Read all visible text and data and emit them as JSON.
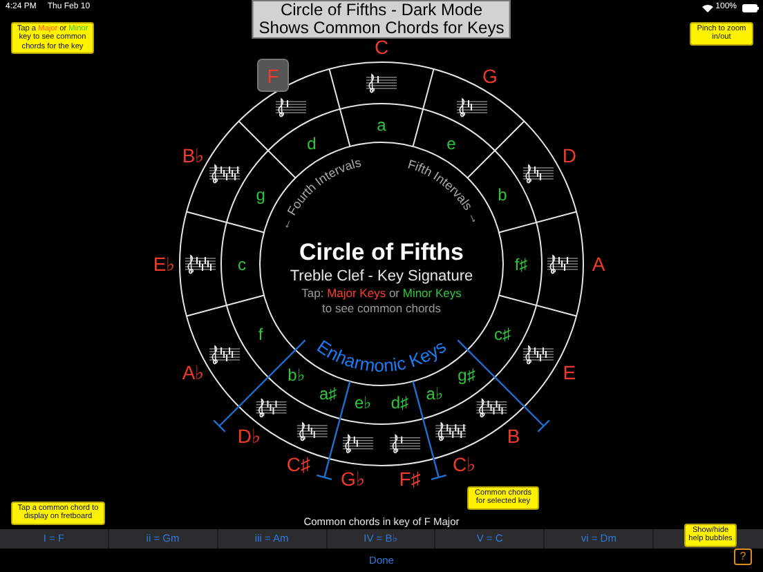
{
  "status_bar": {
    "time": "4:24 PM",
    "date": "Thu Feb 10",
    "battery": "100%"
  },
  "title": [
    "Circle of Fifths - Dark Mode",
    "Shows Common Chords for Keys"
  ],
  "help_bubbles": [
    {
      "segments": [
        {
          "text": "Tap a ",
          "kind": "plain"
        },
        {
          "text": "Major",
          "kind": "major"
        },
        {
          "text": " or ",
          "kind": "plain"
        },
        {
          "text": "Minor",
          "kind": "minor"
        },
        {
          "text": " key to see common chords for the key",
          "kind": "plain"
        }
      ]
    },
    {
      "segments": [
        {
          "text": "Pinch to zoom in/out",
          "kind": "plain"
        }
      ]
    },
    {
      "segments": [
        {
          "text": "Tap a common chord to display on fretboard",
          "kind": "plain"
        }
      ]
    },
    {
      "segments": [
        {
          "text": "Common chords for selected key",
          "kind": "plain"
        }
      ]
    },
    {
      "segments": [
        {
          "text": "Show/hide help bubbles",
          "kind": "plain"
        }
      ]
    }
  ],
  "circle": {
    "title": "Circle of Fifths",
    "subtitle": "Treble Clef - Key Signature",
    "instruction": [
      {
        "text": "Tap: ",
        "kind": "plain"
      },
      {
        "text": "Major Keys",
        "kind": "major"
      },
      {
        "text": " or ",
        "kind": "plain"
      },
      {
        "text": "Minor Keys",
        "kind": "minor"
      }
    ],
    "instruction_line2": "to see common chords",
    "fourth_label": "← Fourth Intervals",
    "fifth_label": "Fifth Intervals →",
    "enharmonic_label": "Enharmonic Keys",
    "major_keys": [
      {
        "label": "C",
        "kind": "key",
        "selected": false
      },
      {
        "label": "G",
        "kind": "key",
        "selected": false
      },
      {
        "label": "D",
        "kind": "key",
        "selected": false
      },
      {
        "label": "A",
        "kind": "key",
        "selected": false
      },
      {
        "label": "E",
        "kind": "key",
        "selected": false
      },
      {
        "label": "B",
        "kind": "enharmonic",
        "selected": false
      },
      {
        "label": "C♭",
        "kind": "enharmonic",
        "selected": false
      },
      {
        "label": "F♯",
        "kind": "enharmonic",
        "selected": false
      },
      {
        "label": "G♭",
        "kind": "enharmonic",
        "selected": false
      },
      {
        "label": "C♯",
        "kind": "enharmonic",
        "selected": false
      },
      {
        "label": "D♭",
        "kind": "enharmonic",
        "selected": false
      },
      {
        "label": "A♭",
        "kind": "key",
        "selected": false
      },
      {
        "label": "E♭",
        "kind": "key",
        "selected": false
      },
      {
        "label": "B♭",
        "kind": "key",
        "selected": false
      },
      {
        "label": "F",
        "kind": "key",
        "selected": true
      }
    ],
    "minor_keys": [
      {
        "label": "a",
        "kind": "key",
        "selected": false
      },
      {
        "label": "e",
        "kind": "key",
        "selected": false
      },
      {
        "label": "b",
        "kind": "key",
        "selected": false
      },
      {
        "label": "f♯",
        "kind": "key",
        "selected": false
      },
      {
        "label": "c♯",
        "kind": "key",
        "selected": false
      },
      {
        "label": "g♯",
        "kind": "enharmonic",
        "selected": false
      },
      {
        "label": "a♭",
        "kind": "enharmonic",
        "selected": false
      },
      {
        "label": "d♯",
        "kind": "enharmonic",
        "selected": false
      },
      {
        "label": "e♭",
        "kind": "enharmonic",
        "selected": false
      },
      {
        "label": "a♯",
        "kind": "enharmonic",
        "selected": false
      },
      {
        "label": "b♭",
        "kind": "enharmonic",
        "selected": false
      },
      {
        "label": "f",
        "kind": "key",
        "selected": false
      },
      {
        "label": "c",
        "kind": "key",
        "selected": false
      },
      {
        "label": "g",
        "kind": "key",
        "selected": false
      },
      {
        "label": "d",
        "kind": "key",
        "selected": false
      }
    ]
  },
  "chords": {
    "caption": "Common chords in key of F Major",
    "items": [
      {
        "label": "I = F"
      },
      {
        "label": "ii = Gm"
      },
      {
        "label": "iii = Am"
      },
      {
        "label": "IV = B♭"
      },
      {
        "label": "V = C"
      },
      {
        "label": "vi = Dm"
      }
    ],
    "done": "Done"
  },
  "help_button": "?"
}
